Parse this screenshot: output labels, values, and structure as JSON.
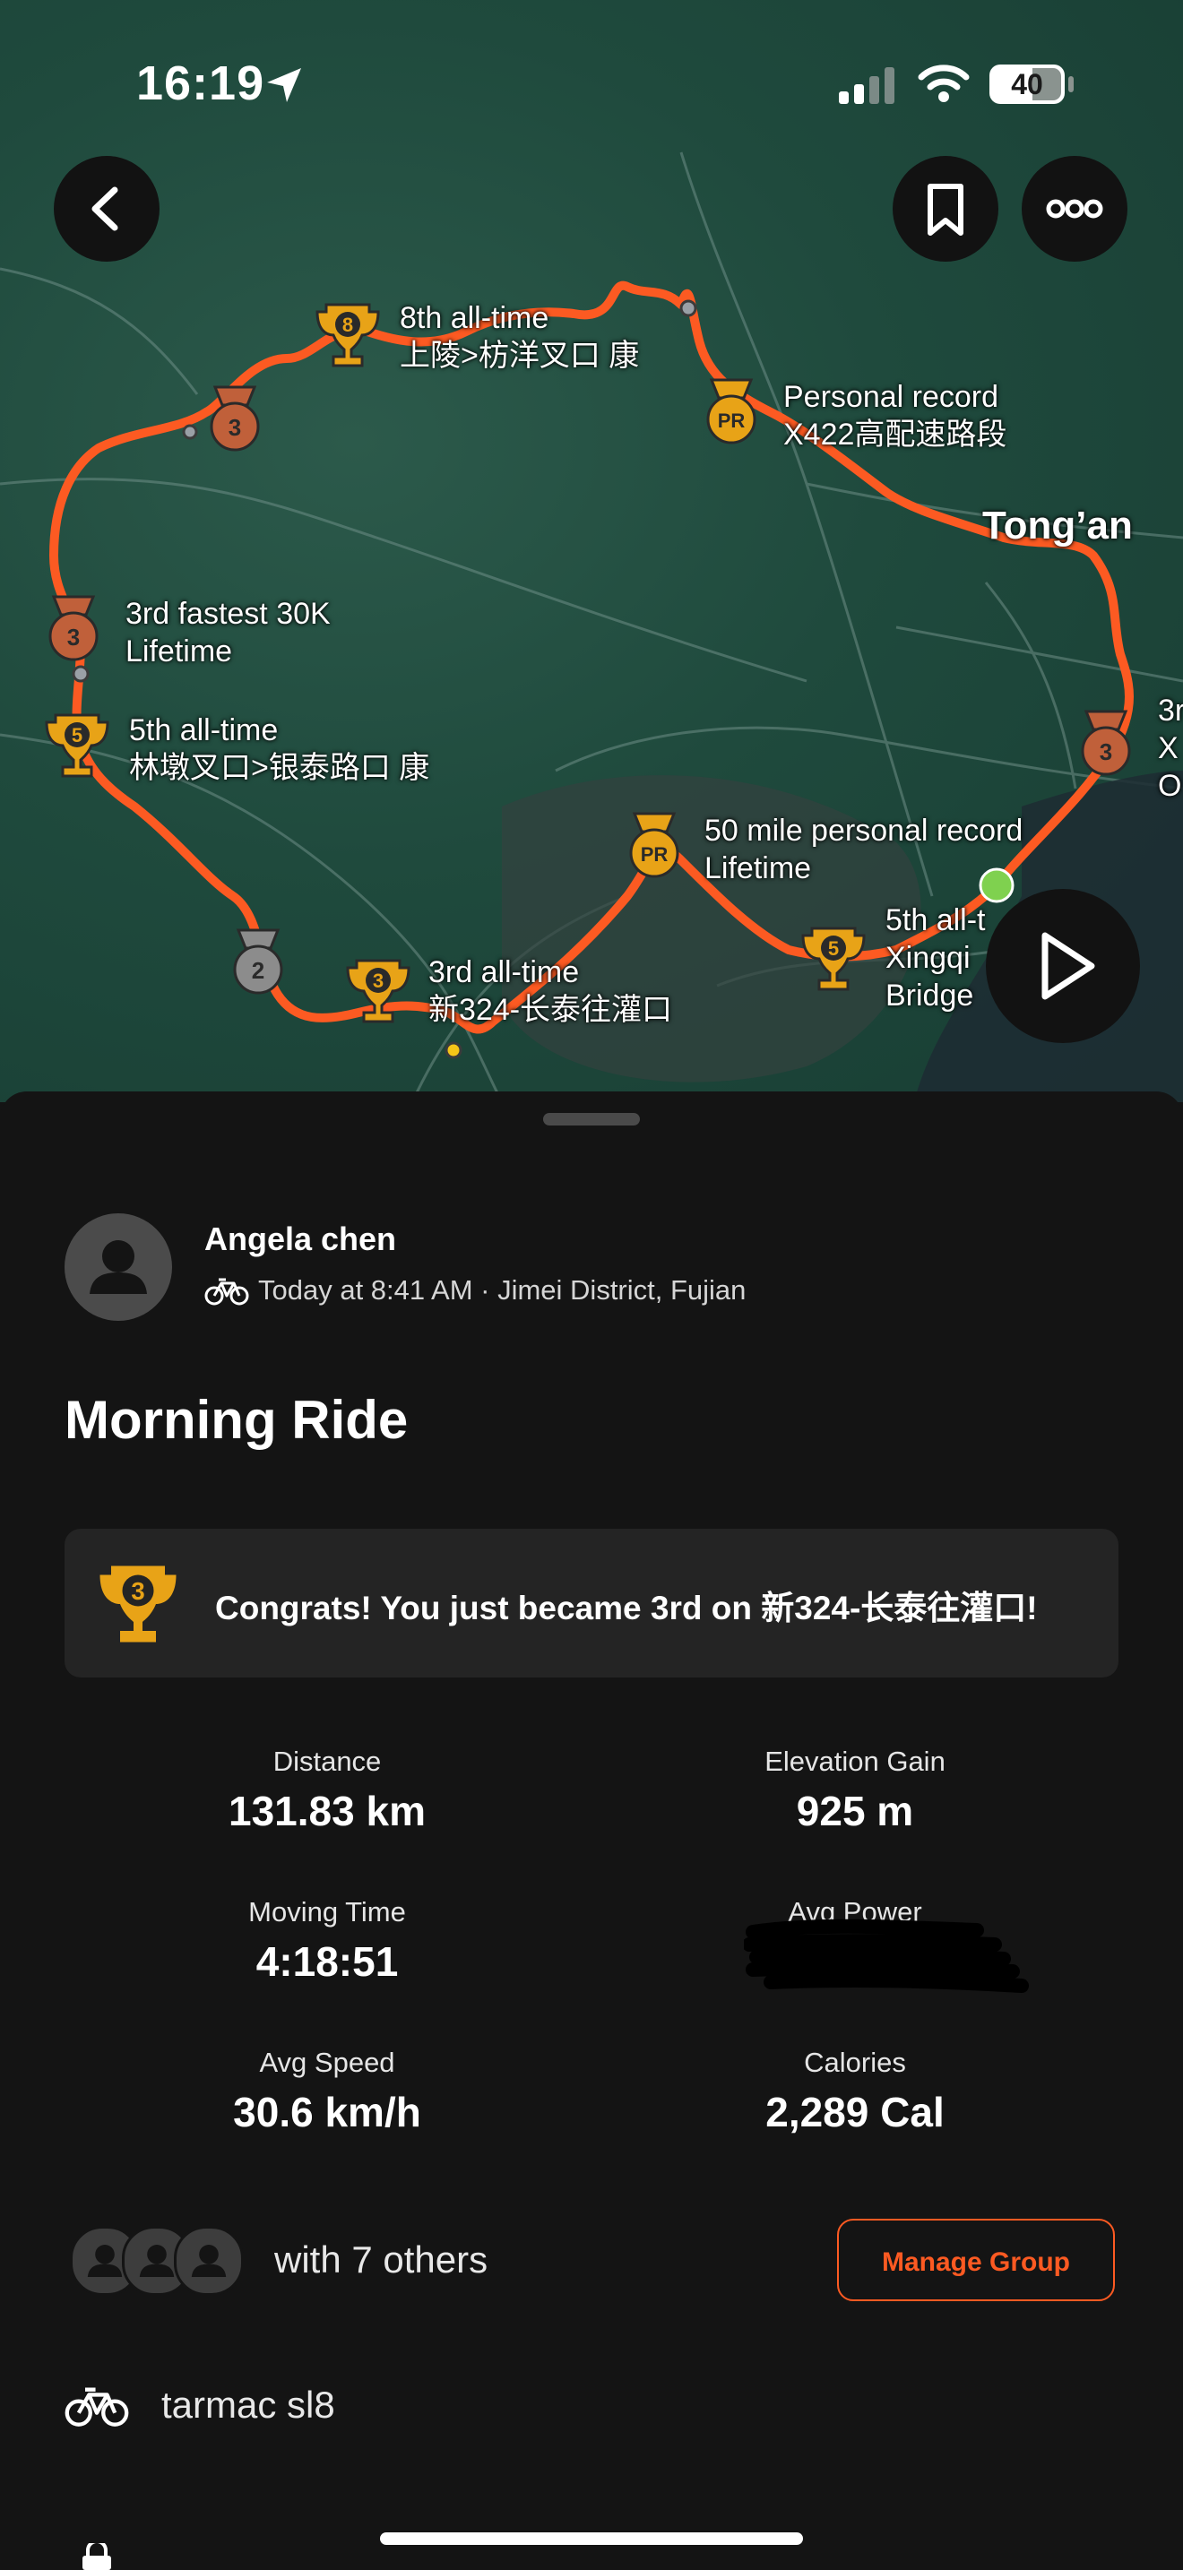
{
  "status_bar": {
    "time": "16:19",
    "battery": "40"
  },
  "map": {
    "city_label": "Tong’an",
    "annotations": [
      {
        "text": "8th all-time\n上陵>枋洋叉口 康"
      },
      {
        "text": "Personal record\nX422高配速路段"
      },
      {
        "text": "3rd fastest 30K\nLifetime"
      },
      {
        "text": "5th all-time\n林墩叉口>银泰路口 康"
      },
      {
        "text": "50 mile personal record\nLifetime"
      },
      {
        "text": "3rd all-time\n新324-长泰往灌口"
      },
      {
        "text": "5th all-t\nXingqi\nBridge"
      },
      {
        "text": "3r\nX\nO"
      }
    ],
    "medal_numbers": [
      "8",
      "PR",
      "3",
      "3",
      "5",
      "PR",
      "2",
      "3",
      "5",
      "3"
    ],
    "route_color": "#fc5a22"
  },
  "activity": {
    "athlete_name": "Angela chen",
    "subline": "Today at 8:41 AM · Jimei District, Fujian",
    "title": "Morning Ride",
    "congrats": "Congrats! You just became 3rd on 新324-长泰往灌口!",
    "congrats_trophy_number": "3",
    "stats": [
      {
        "label": "Distance",
        "value": "131.83 km"
      },
      {
        "label": "Elevation Gain",
        "value": "925 m"
      },
      {
        "label": "Moving Time",
        "value": "4:18:51"
      },
      {
        "label": "Avg Power",
        "value": ""
      },
      {
        "label": "Avg Speed",
        "value": "30.6 km/h"
      },
      {
        "label": "Calories",
        "value": "2,289 Cal"
      }
    ],
    "group_text": "with 7 others",
    "manage_group": "Manage Group",
    "gear": "tarmac sl8"
  },
  "colors": {
    "accent": "#fc5a22",
    "trophy_gold": "#e8a317",
    "medal_bronze": "#c0603a",
    "medal_silver": "#8c8c8c"
  }
}
